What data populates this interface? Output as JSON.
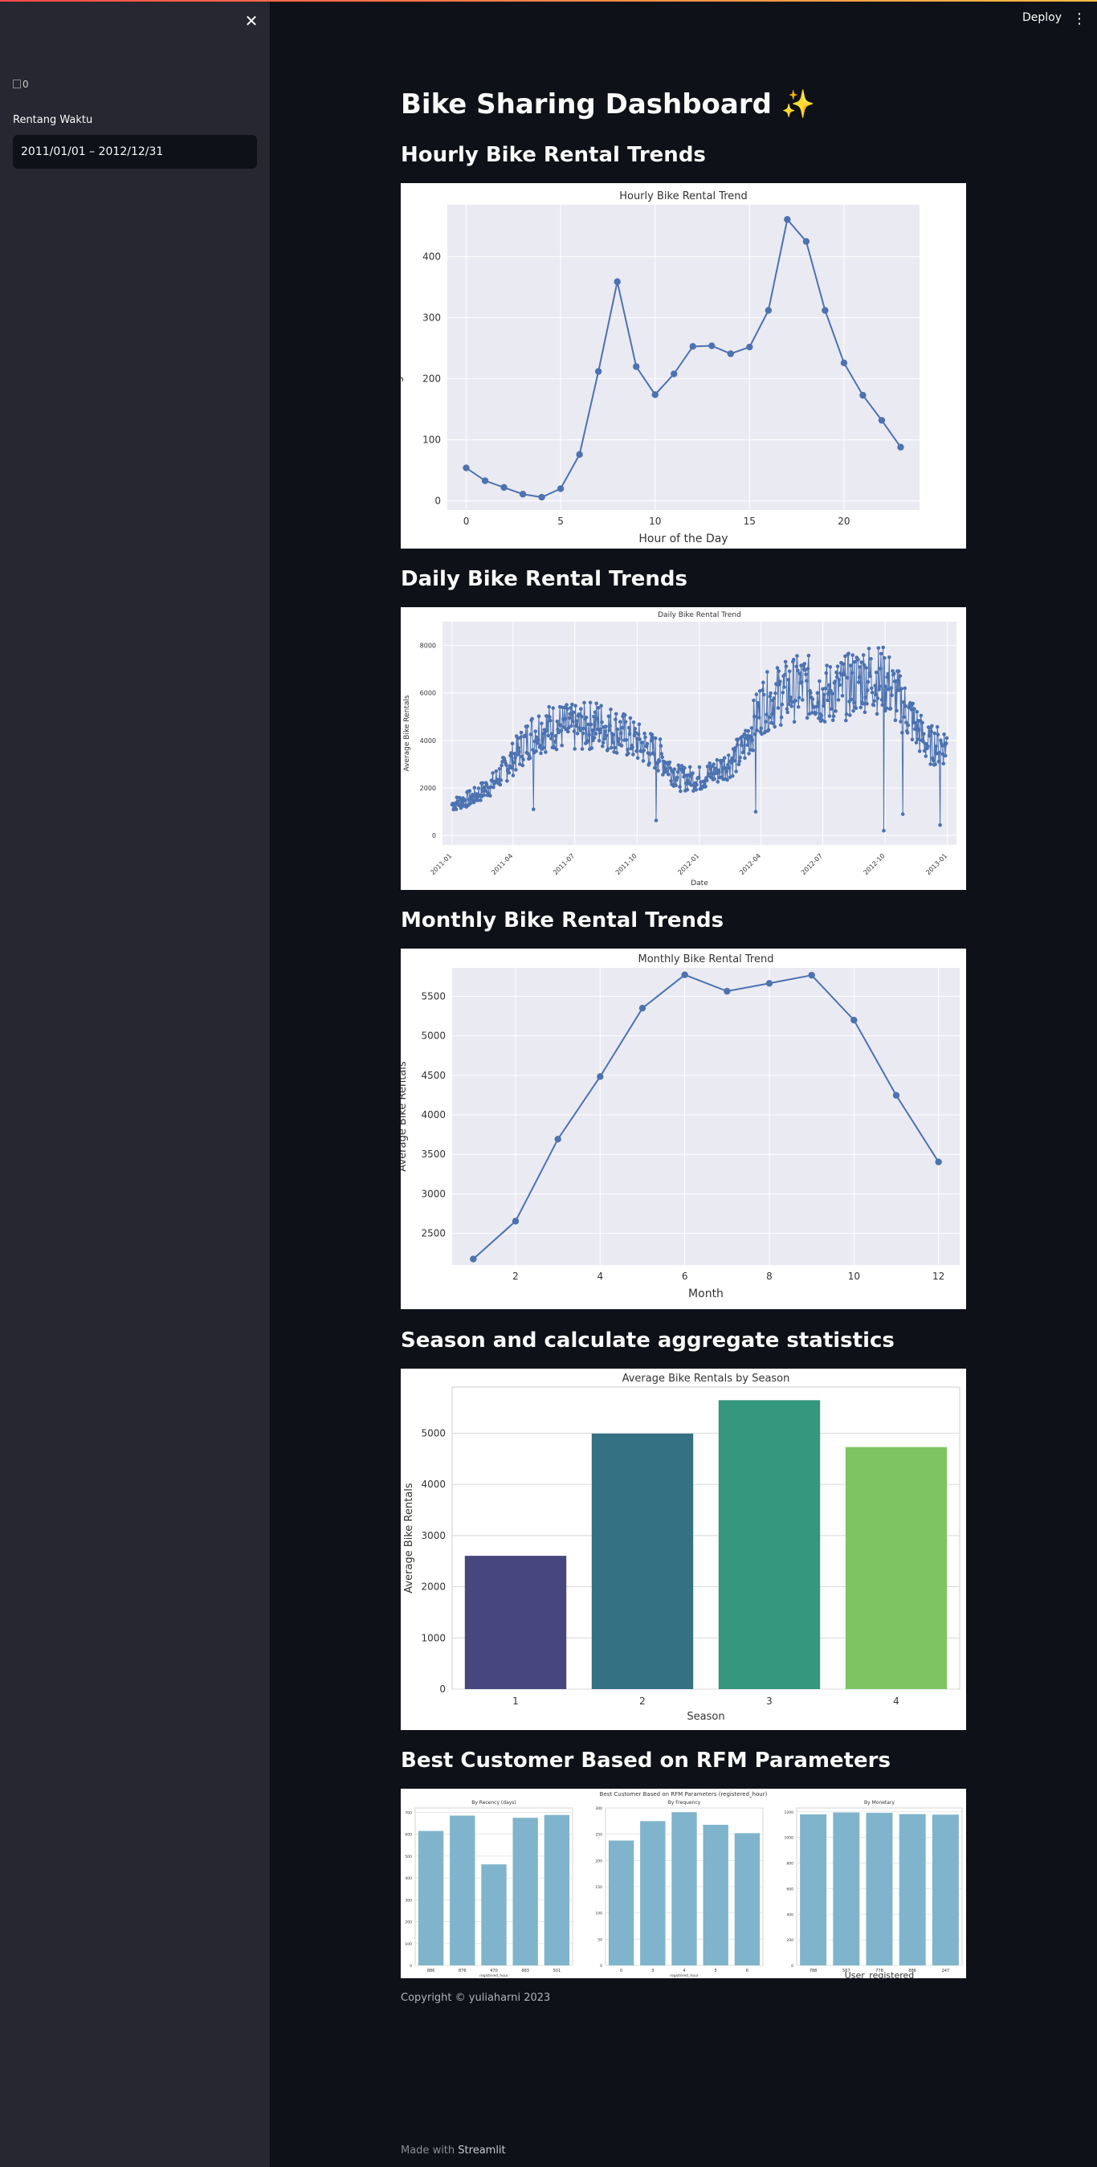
{
  "sidebar": {
    "logo_alt": "0",
    "date_label": "Rentang Waktu",
    "date_value": "2011/01/01 – 2012/12/31"
  },
  "header": {
    "deploy_label": "Deploy"
  },
  "page": {
    "title": "Bike Sharing Dashboard ✨",
    "sections": {
      "hourly": "Hourly Bike Rental Trends",
      "daily": "Daily Bike Rental Trends",
      "monthly": "Monthly Bike Rental Trends",
      "season": "Season and calculate aggregate statistics",
      "rfm": "Best Customer Based on RFM Parameters"
    },
    "copyright": "Copyright © yuliaharni 2023"
  },
  "footer": {
    "made_with": "Made with ",
    "brand": "Streamlit"
  },
  "colors": {
    "line": "#4c72b0",
    "plot_bg": "#eaeaf2",
    "season_bars": [
      "#48477d",
      "#347283",
      "#35977d",
      "#7ec463"
    ],
    "rfm_bar": "#7fb4cc"
  },
  "chart_data": [
    {
      "id": "hourly",
      "type": "line",
      "title": "Hourly Bike Rental Trend",
      "xlabel": "Hour of the Day",
      "ylabel": "Average Bike Rentals",
      "x": [
        0,
        1,
        2,
        3,
        4,
        5,
        6,
        7,
        8,
        9,
        10,
        11,
        12,
        13,
        14,
        15,
        16,
        17,
        18,
        19,
        20,
        21,
        22,
        23
      ],
      "y": [
        54,
        33,
        22,
        11,
        6,
        20,
        76,
        212,
        359,
        220,
        174,
        208,
        253,
        254,
        241,
        252,
        312,
        461,
        425,
        312,
        226,
        173,
        132,
        88
      ],
      "xlim": [
        -1,
        24
      ],
      "ylim": [
        -15,
        485
      ],
      "xticks": [
        0,
        5,
        10,
        15,
        20
      ],
      "yticks": [
        0,
        100,
        200,
        300,
        400
      ],
      "grid": true
    },
    {
      "id": "daily",
      "type": "line",
      "title": "Daily Bike Rental Trend",
      "xlabel": "Date",
      "ylabel": "Average Bike Rentals",
      "xticks": [
        "2011-01",
        "2011-04",
        "2011-07",
        "2011-10",
        "2012-01",
        "2012-04",
        "2012-07",
        "2012-10",
        "2013-01"
      ],
      "x_range": [
        "2011-01-01",
        "2012-12-31"
      ],
      "ylim": [
        -400,
        9000
      ],
      "yticks": [
        0,
        2000,
        4000,
        6000,
        8000
      ],
      "monthly_levels": [
        1300,
        1600,
        2200,
        3300,
        4400,
        4600,
        4500,
        4700,
        4400,
        3900,
        3400,
        2400,
        2400,
        2800,
        3500,
        5500,
        6000,
        6300,
        5900,
        6200,
        6700,
        6500,
        5200,
        3800
      ],
      "outliers": [
        [
          120,
          1100
        ],
        [
          301,
          630
        ],
        [
          353,
          2120
        ],
        [
          448,
          1000
        ],
        [
          637,
          200
        ],
        [
          665,
          900
        ],
        [
          720,
          440
        ]
      ],
      "grid": true
    },
    {
      "id": "monthly",
      "type": "line",
      "title": "Monthly Bike Rental Trend",
      "xlabel": "Month",
      "ylabel": "Average Bike Rentals",
      "x": [
        1,
        2,
        3,
        4,
        5,
        6,
        7,
        8,
        9,
        10,
        11,
        12
      ],
      "y": [
        2176,
        2655,
        3692,
        4485,
        5350,
        5772,
        5564,
        5664,
        5767,
        5199,
        4247,
        3404
      ],
      "xlim": [
        0.5,
        12.5
      ],
      "ylim": [
        2100,
        5860
      ],
      "xticks": [
        2,
        4,
        6,
        8,
        10,
        12
      ],
      "yticks": [
        2500,
        3000,
        3500,
        4000,
        4500,
        5000,
        5500
      ],
      "grid": true
    },
    {
      "id": "season",
      "type": "bar",
      "title": "Average Bike Rentals by Season",
      "xlabel": "Season",
      "ylabel": "Average Bike Rentals",
      "categories": [
        "1",
        "2",
        "3",
        "4"
      ],
      "values": [
        2604,
        4992,
        5644,
        4728
      ],
      "ylim": [
        0,
        5900
      ],
      "yticks": [
        0,
        1000,
        2000,
        3000,
        4000,
        5000
      ],
      "grid": true
    },
    {
      "id": "rfm",
      "type": "bar",
      "title": "Best Customer Based on RFM Parameters (registered_hour)",
      "panels": [
        {
          "title": "By Recency (days)",
          "categories": [
            "886",
            "876",
            "470",
            "883",
            "501"
          ],
          "values": [
            615,
            685,
            462,
            675,
            688
          ],
          "xlabel": "registered_hour",
          "ylim": [
            0,
            720
          ],
          "yticks": [
            0,
            100,
            200,
            300,
            400,
            500,
            600,
            700
          ],
          "big_xlabel": false
        },
        {
          "title": "By Frequency",
          "categories": [
            "0",
            "3",
            "4",
            "5",
            "6"
          ],
          "values": [
            238,
            275,
            292,
            268,
            252
          ],
          "xlabel": "registered_hour",
          "ylim": [
            0,
            300
          ],
          "yticks": [
            0,
            50,
            100,
            150,
            200,
            250,
            300
          ],
          "big_xlabel": false
        },
        {
          "title": "By Monetary",
          "categories": [
            "788",
            "567",
            "778",
            "886",
            "247"
          ],
          "values": [
            1180,
            1195,
            1192,
            1182,
            1178
          ],
          "xlabel": "User_registered",
          "ylim": [
            0,
            1230
          ],
          "yticks": [
            0,
            200,
            400,
            600,
            800,
            1000,
            1200
          ],
          "big_xlabel": true
        }
      ]
    }
  ]
}
